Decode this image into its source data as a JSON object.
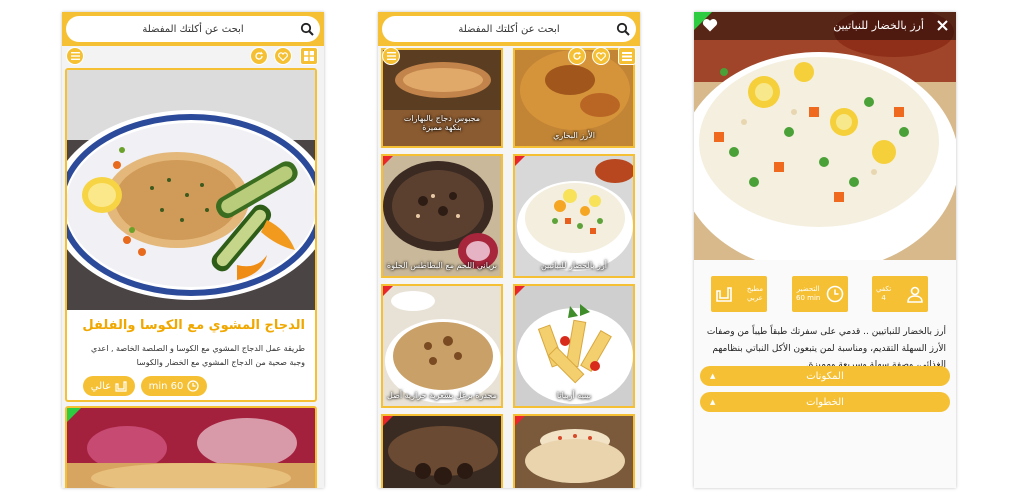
{
  "search": {
    "placeholder": "ابحث عن أكلتك المفضلة"
  },
  "phone1": {
    "card": {
      "title": "الدجاج المشوي مع الكوسا والفلفل",
      "description": "طريقة عمل الدجاج المشوي مع الكوسا و الصلصة الخاصة , اعدي وجبة صحية من الدجاج المشوي مع الخضار والكوسا",
      "time": "60 min",
      "difficulty": "عالي"
    }
  },
  "phone2": {
    "tiles": [
      {
        "label": "مجبوس دجاج بالبهارات بنكهة مميزة"
      },
      {
        "label": "الأرز البخاري"
      },
      {
        "label": "برياني اللحم مع البطاطس الحلوة"
      },
      {
        "label": "أرز بالخضار للنباتيين"
      },
      {
        "label": "مجدرة برغل بشعرية حرارية أصل"
      },
      {
        "label": "بينيه أربياتا"
      },
      {
        "label": ""
      },
      {
        "label": ""
      }
    ]
  },
  "phone3": {
    "title": "أرز بالخضار للنباتيين",
    "stats": {
      "serves_label": "تكفي",
      "serves_value": "4",
      "prep_label": "التحضير",
      "prep_value": "60 min",
      "cuisine_label": "مطبخ",
      "cuisine_value": "عربي"
    },
    "description": "أرز بالخضار للنباتيين .. قدمي على سفرتك طبقاً طيباً من وصفات الأرز السهلة التقديم، ومناسبة لمن يتبعون الأكل النباتي بنظامهم الغذائي، وصفة سهلة وسريعة ومميزة.",
    "ingredients_label": "المكونات",
    "steps_label": "الخطوات"
  },
  "colors": {
    "accent": "#f5c033",
    "badge_red": "#e8262b",
    "badge_green": "#2ecc40"
  },
  "icons": [
    "search-icon",
    "menu-icon",
    "refresh-icon",
    "heart-icon",
    "grid-icon",
    "list-icon",
    "clock-icon",
    "chef-icon",
    "close-icon",
    "person-icon"
  ]
}
